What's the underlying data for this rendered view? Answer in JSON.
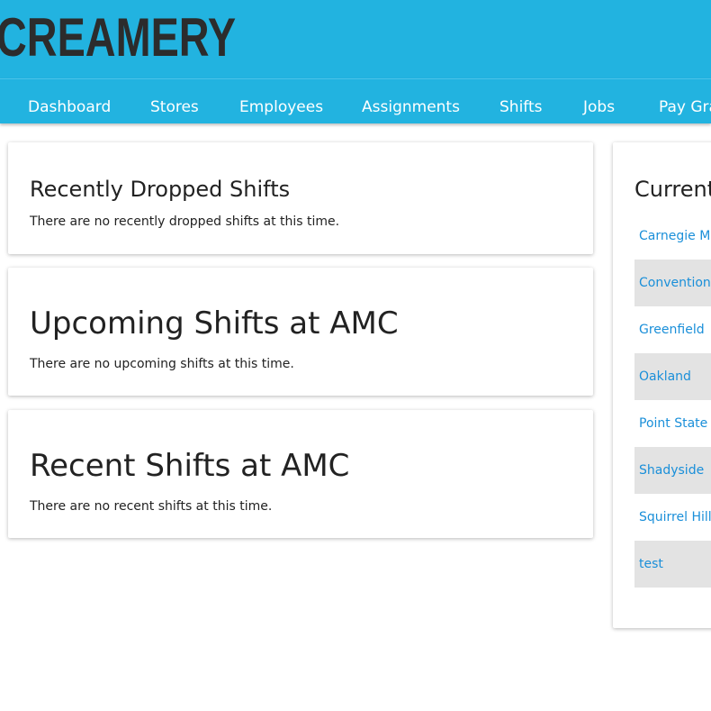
{
  "brand": {
    "logo_text": "CREAMERY"
  },
  "nav": {
    "items": [
      {
        "label": "Dashboard"
      },
      {
        "label": "Stores"
      },
      {
        "label": "Employees"
      },
      {
        "label": "Assignments"
      },
      {
        "label": "Shifts"
      },
      {
        "label": "Jobs"
      },
      {
        "label": "Pay Gra"
      }
    ]
  },
  "dropped": {
    "title": "Recently Dropped Shifts",
    "message": "There are no recently dropped shifts at this time."
  },
  "upcoming": {
    "title": "Upcoming Shifts at AMC",
    "message": "There are no upcoming shifts at this time."
  },
  "recent": {
    "title": "Recent Shifts at AMC",
    "message": "There are no recent shifts at this time."
  },
  "stores_panel": {
    "title": "Current",
    "stores": [
      {
        "name": "Carnegie Me"
      },
      {
        "name": "Convention"
      },
      {
        "name": "Greenfield"
      },
      {
        "name": "Oakland"
      },
      {
        "name": "Point State I"
      },
      {
        "name": "Shadyside"
      },
      {
        "name": "Squirrel Hill"
      },
      {
        "name": "test"
      }
    ]
  },
  "colors": {
    "header_bg": "#22b3e0",
    "link": "#1a8fd9",
    "row_alt": "#e3e3e3"
  }
}
